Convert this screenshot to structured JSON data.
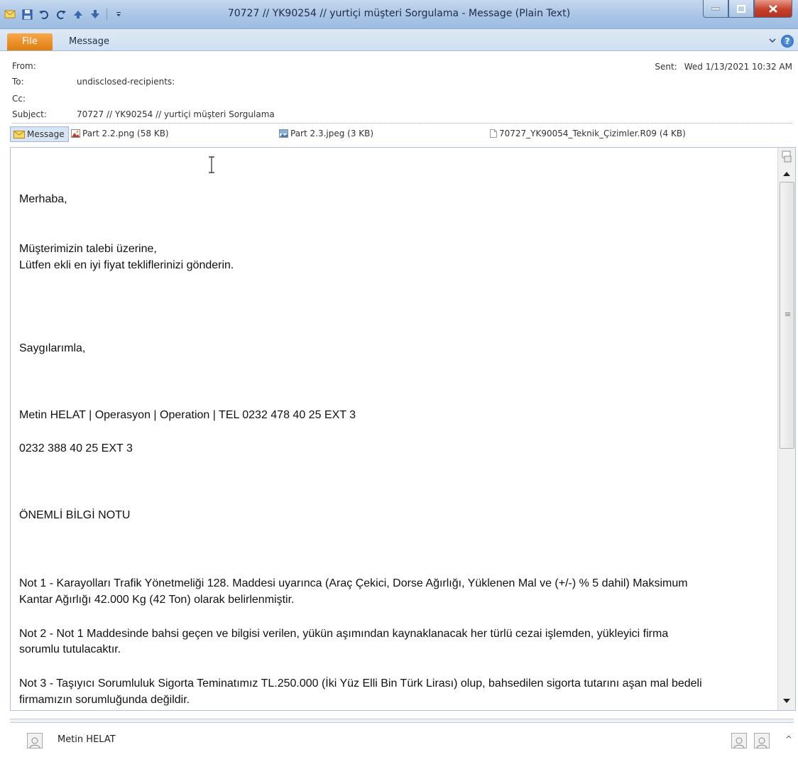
{
  "window": {
    "title": "70727 // YK90254 // yurtiçi müşteri Sorgulama - Message (Plain Text)"
  },
  "quick_access": {
    "icons": [
      "mail-icon",
      "save-icon",
      "undo-icon",
      "redo-icon",
      "previous-item-icon",
      "next-item-icon",
      "customize-qat-icon"
    ]
  },
  "ribbon": {
    "file_tab": "File",
    "message_tab": "Message",
    "help_glyph": "?"
  },
  "header": {
    "from_label": "From:",
    "from_value": "",
    "to_label": "To:",
    "to_value": "undisclosed-recipients:",
    "cc_label": "Cc:",
    "cc_value": "",
    "subject_label": "Subject:",
    "subject_value": "70727 // YK90254 // yurtiçi müşteri Sorgulama",
    "sent_label": "Sent:",
    "sent_value": "Wed 1/13/2021 10:32 AM"
  },
  "attachments": {
    "message_tab": "Message",
    "items": [
      "Part 2.2.png (58 KB)",
      "Part 2.3.jpeg (3 KB)",
      "70727_YK90054_Teknik_Çizimler.R09 (4 KB)"
    ]
  },
  "body": {
    "lines": [
      "Merhaba,",
      "Müşterimizin talebi üzerine,",
      "Lütfen ekli en iyi fiyat tekliflerinizi gönderin.",
      "Saygılarımla,",
      "Metin HELAT | Operasyon | Operation | TEL 0232 478 40 25 EXT  3",
      "0232 388 40 25  EXT 3",
      "ÖNEMLİ BİLGİ NOTU",
      "Not 1 - Karayolları Trafik Yönetmeliği 128. Maddesi uyarınca (Araç Çekici, Dorse Ağırlığı, Yüklenen Mal ve (+/-) % 5 dahil) Maksimum",
      "Kantar Ağırlığı  42.000 Kg (42 Ton) olarak belirlenmiştir.",
      "Not 2 - Not 1 Maddesinde bahsi geçen ve bilgisi verilen, yükün aşımından kaynaklanacak her türlü cezai işlemden, yükleyici firma",
      "sorumlu tutulacaktır.",
      "Not 3 - Taşıyıcı Sorumluluk Sigorta Teminatımız TL.250.000 (İki Yüz Elli Bin Türk Lirası) olup, bahsedilen sigorta tutarını aşan mal bedeli",
      "firmamızın sorumluğunda değildir."
    ]
  },
  "people_pane": {
    "name": "Metin HELAT",
    "collapse_glyph": "^"
  }
}
